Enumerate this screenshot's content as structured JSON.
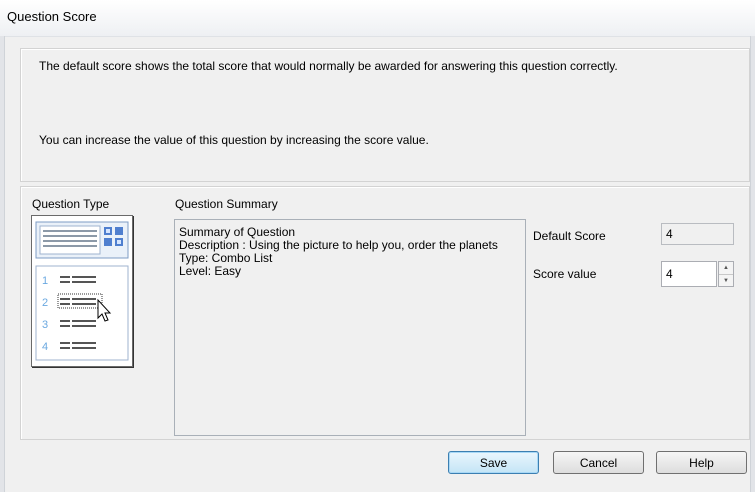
{
  "window": {
    "title": "Question Score"
  },
  "info": {
    "line1": "The default score shows the total score that would normally be awarded for answering this question correctly.",
    "line2": "You can increase the value of this question by increasing the score value."
  },
  "question_type": {
    "label": "Question Type",
    "thumbnail": {
      "numbers": [
        "1",
        "2",
        "3",
        "4"
      ],
      "icon": "combo-list-question-icon"
    }
  },
  "summary": {
    "label": "Question Summary",
    "lines": [
      "Summary of Question",
      "Description : Using the picture to help you, order the planets",
      "Type: Combo List",
      "Level: Easy"
    ]
  },
  "default_score": {
    "label": "Default Score",
    "value": "4"
  },
  "score_value": {
    "label": "Score value",
    "value": "4"
  },
  "buttons": {
    "save": "Save",
    "cancel": "Cancel",
    "help": "Help"
  }
}
